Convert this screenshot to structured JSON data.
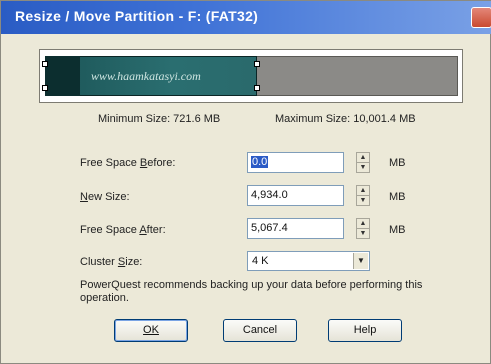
{
  "window": {
    "title": "Resize / Move Partition - F: (FAT32)",
    "close_glyph": "✕"
  },
  "partition_map": {
    "watermark": "www.haamkatasyi.com",
    "used_fraction": 0.5,
    "colors": {
      "used": "#2a6e70",
      "free": "#8b8a87"
    }
  },
  "sizes": {
    "minimum": "Minimum Size:  721.6 MB",
    "maximum": "Maximum Size:  10,001.4 MB"
  },
  "fields": {
    "free_before": {
      "label_pre": "Free Space ",
      "label_u": "B",
      "label_post": "efore:",
      "value": "0.0",
      "unit": "MB"
    },
    "new_size": {
      "label_pre": "",
      "label_u": "N",
      "label_post": "ew Size:",
      "value": "4,934.0",
      "unit": "MB"
    },
    "free_after": {
      "label_pre": "Free Space ",
      "label_u": "A",
      "label_post": "fter:",
      "value": "5,067.4",
      "unit": "MB"
    },
    "cluster": {
      "label_pre": "Cluster ",
      "label_u": "S",
      "label_post": "ize:",
      "value": "4 K"
    }
  },
  "note": "PowerQuest recommends backing up your data before performing this operation.",
  "buttons": {
    "ok": "OK",
    "cancel": "Cancel",
    "help": "Help"
  },
  "icons": {
    "spin_up": "▲",
    "spin_down": "▼",
    "dropdown": "▼"
  }
}
